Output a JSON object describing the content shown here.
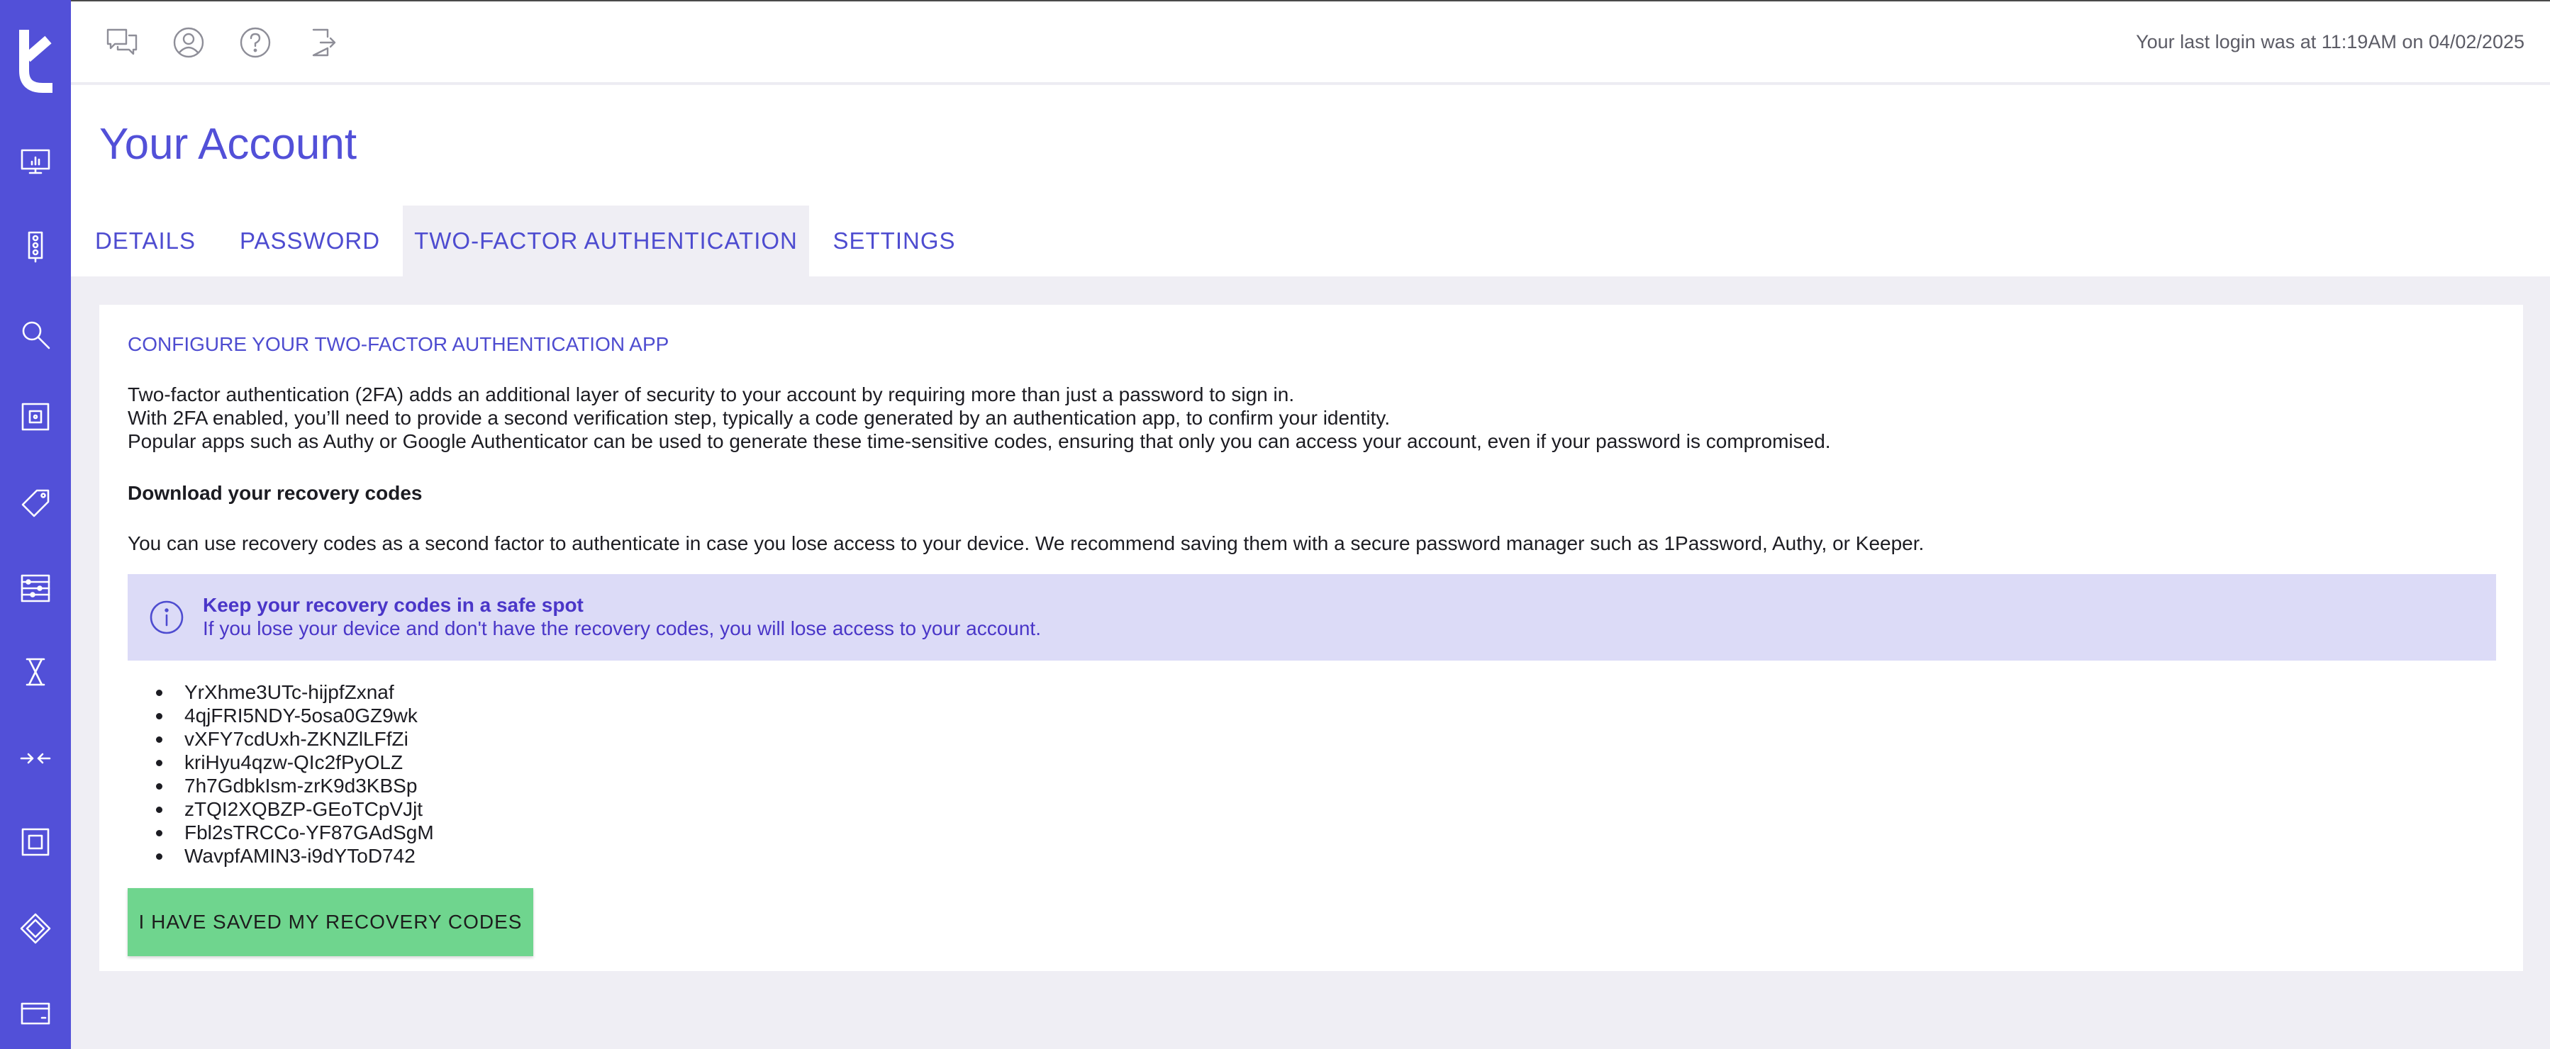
{
  "topbar": {
    "icons": [
      "chat-icon",
      "user-icon",
      "help-icon",
      "logout-icon"
    ],
    "last_login": "Your last login was at 11:19AM on 04/02/2025"
  },
  "sidebar": {
    "icons": [
      "monitor-chart-icon",
      "traffic-light-icon",
      "search-icon",
      "vault-icon",
      "tag-icon",
      "abacus-icon",
      "hourglass-icon",
      "merge-arrows-icon",
      "safe-icon",
      "ticket-icon",
      "card-icon"
    ]
  },
  "page": {
    "title": "Your Account",
    "tabs": [
      "DETAILS",
      "PASSWORD",
      "TWO-FACTOR AUTHENTICATION",
      "SETTINGS"
    ],
    "active_tab": "TWO-FACTOR AUTHENTICATION"
  },
  "card": {
    "section_title": "CONFIGURE YOUR TWO-FACTOR AUTHENTICATION APP",
    "intro_lines": [
      "Two-factor authentication (2FA) adds an additional layer of security to your account by requiring more than just a password to sign in.",
      "With 2FA enabled, you’ll need to provide a second verification step, typically a code generated by an authentication app, to confirm your identity.",
      "Popular apps such as Authy or Google Authenticator can be used to generate these time-sensitive codes, ensuring that only you can access your account, even if your password is compromised."
    ],
    "download_heading": "Download your recovery codes",
    "download_text": "You can use recovery codes as a second factor to authenticate in case you lose access to your device. We recommend saving them with a secure password manager such as 1Password, Authy, or Keeper.",
    "alert": {
      "title": "Keep your recovery codes in a safe spot",
      "body": "If you lose your device and don't have the recovery codes, you will lose access to your account."
    },
    "recovery_codes": [
      "YrXhme3UTc-hijpfZxnaf",
      "4qjFRI5NDY-5osa0GZ9wk",
      "vXFY7cdUxh-ZKNZlLFfZi",
      "kriHyu4qzw-QIc2fPyOLZ",
      "7h7GdbkIsm-zrK9d3KBSp",
      "zTQI2XQBZP-GEoTCpVJjt",
      "Fbl2sTRCCo-YF87GAdSgM",
      "WavpfAMIN3-i9dYToD742"
    ],
    "save_button": "I HAVE SAVED MY RECOVERY CODES"
  },
  "colors": {
    "brand": "#5250d8",
    "alert_bg": "#dcdbf7",
    "button_green": "#6fd58e",
    "page_bg": "#efeef4"
  }
}
